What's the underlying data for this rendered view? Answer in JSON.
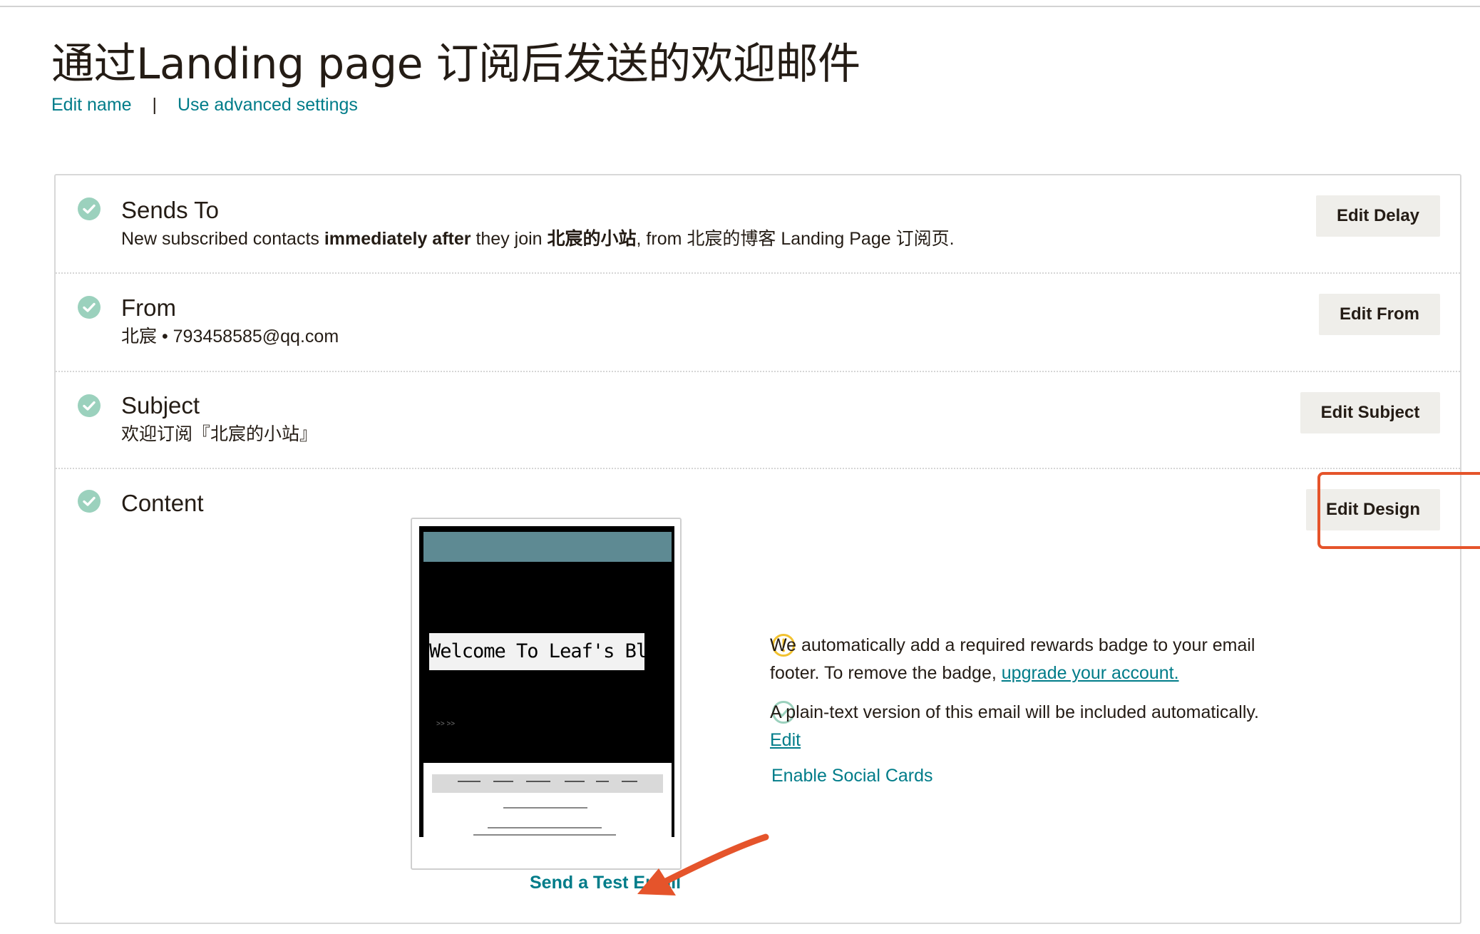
{
  "page": {
    "title": "通过Landing page 订阅后发送的欢迎邮件",
    "edit_name": "Edit name",
    "separator": "|",
    "advanced_settings": "Use advanced settings"
  },
  "sends_to": {
    "title": "Sends To",
    "desc_1": "New subscribed contacts ",
    "desc_bold_1": "immediately after",
    "desc_2": " they join ",
    "desc_bold_2": "北宸的小站",
    "desc_3": ", from 北宸的博客 Landing Page 订阅页.",
    "button": "Edit Delay"
  },
  "from": {
    "title": "From",
    "desc": "北宸 • 793458585@qq.com",
    "button": "Edit From"
  },
  "subject": {
    "title": "Subject",
    "desc": "欢迎订阅『北宸的小站』",
    "button": "Edit Subject"
  },
  "content": {
    "title": "Content",
    "button": "Edit Design",
    "preview_banner": "Welcome To Leaf's Blog",
    "preview_dots": ">> >>",
    "notice_badge_1": "We automatically add a required rewards badge to your email",
    "notice_badge_2": "footer. To remove the badge, ",
    "notice_badge_link": "upgrade your account.",
    "notice_plaintext": "A plain-text version of this email will be included automatically.",
    "notice_plaintext_link": "Edit",
    "social_cards": "Enable Social Cards",
    "test_email": "Send a Test Email"
  },
  "colors": {
    "link": "#007c89",
    "check": "#9bd1bd",
    "warning": "#f2c230",
    "highlight": "#e5542b",
    "button_bg": "#efeeea"
  },
  "icons": {
    "status": "check-circle-icon",
    "warning": "warning-circle-icon",
    "plaintext": "check-outline-icon"
  }
}
